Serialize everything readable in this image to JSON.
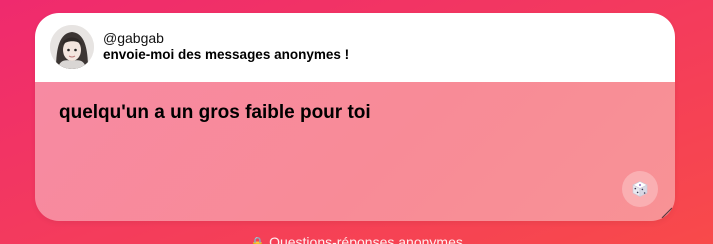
{
  "profile": {
    "username": "@gabgab",
    "prompt": "envoie-moi des messages anonymes !"
  },
  "message": {
    "text": "quelqu'un a un gros faible pour toi"
  },
  "dice_button": {
    "icon": "dice-icon"
  },
  "footer": {
    "icon": "lock-icon",
    "label": "Questions-réponses anonymes"
  },
  "colors": {
    "background_start": "#ef2a6e",
    "background_end": "#f84a4a",
    "card_header": "#ffffff",
    "card_body": "#f88b97"
  }
}
